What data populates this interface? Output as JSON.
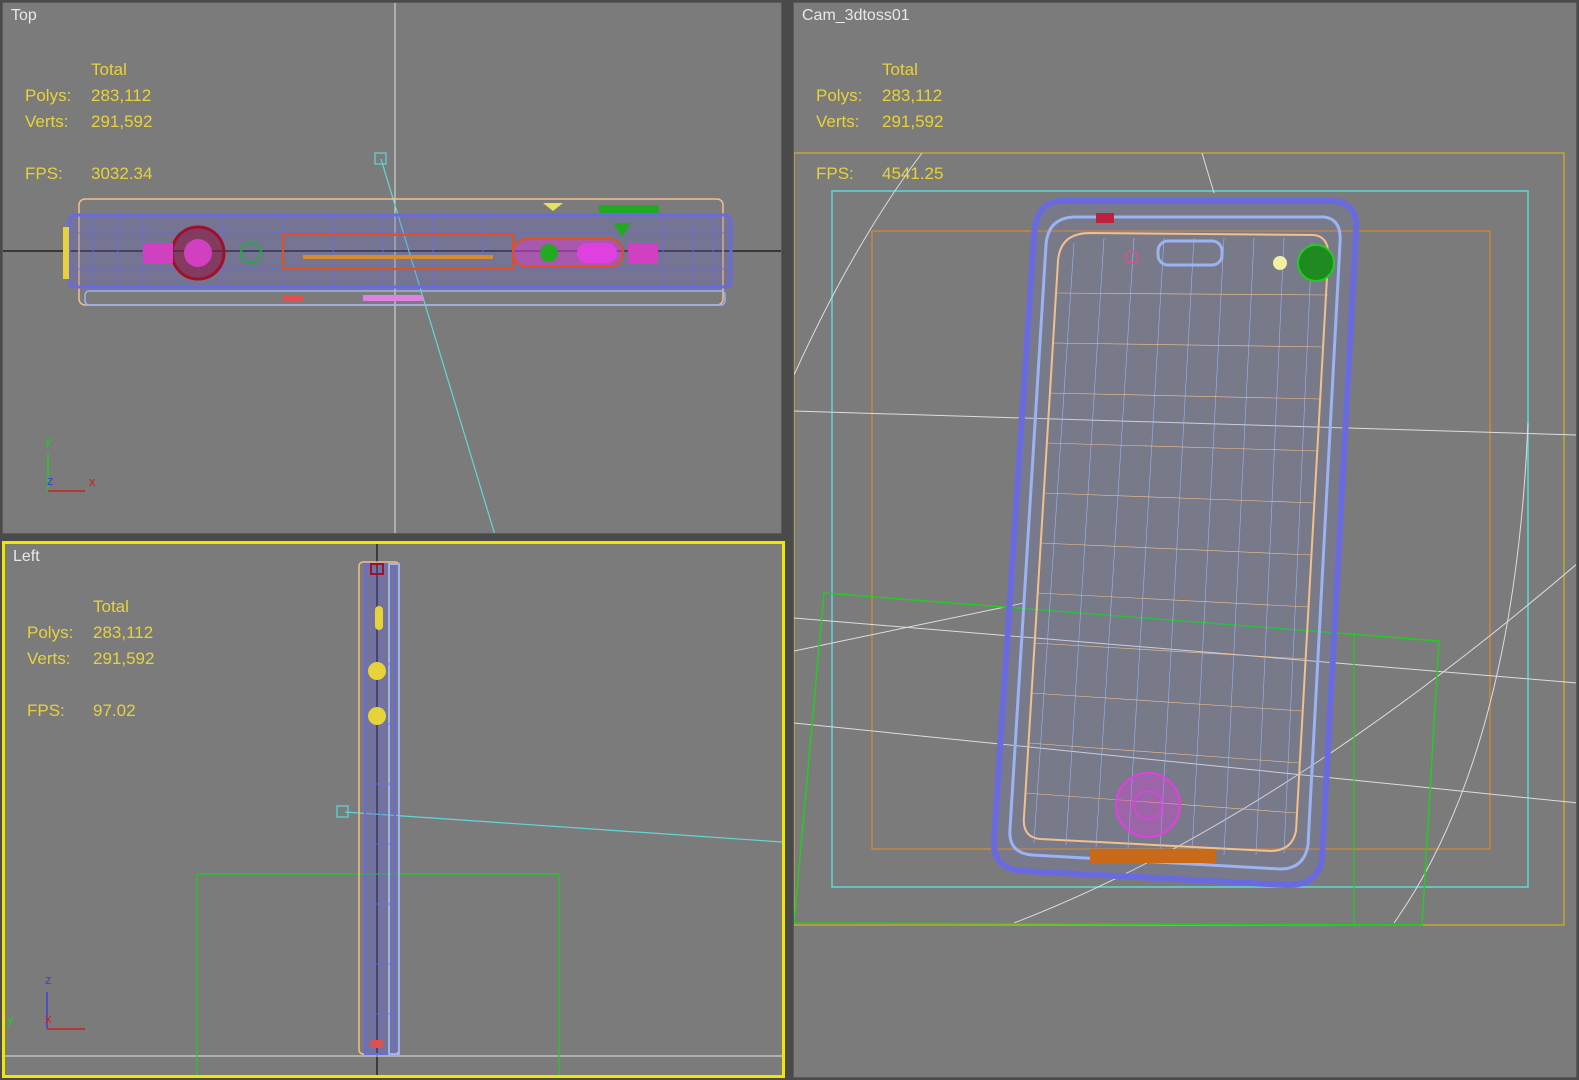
{
  "viewports": {
    "top": {
      "label": "Top",
      "stats": {
        "header": "Total",
        "polys_label": "Polys:",
        "polys": "283,112",
        "verts_label": "Verts:",
        "verts": "291,592",
        "fps_label": "FPS:",
        "fps": "3032.34"
      },
      "axes": {
        "v": "y",
        "h": "x",
        "d": "z"
      }
    },
    "left": {
      "label": "Left",
      "stats": {
        "header": "Total",
        "polys_label": "Polys:",
        "polys": "283,112",
        "verts_label": "Verts:",
        "verts": "291,592",
        "fps_label": "FPS:",
        "fps": "97.02"
      },
      "axes": {
        "v": "z",
        "h": "x",
        "d": "y"
      }
    },
    "cam": {
      "label": "Cam_3dtoss01",
      "stats": {
        "header": "Total",
        "polys_label": "Polys:",
        "polys": "283,112",
        "verts_label": "Verts:",
        "verts": "291,592",
        "fps_label": "FPS:",
        "fps": "4541.25"
      }
    }
  },
  "colors": {
    "viewport_bg": "#7b7b7b",
    "active_border": "#f2e600",
    "stats_text": "#e8d23a",
    "wire_blue": "#6a6ae0",
    "wire_light_blue": "#9bb3f2",
    "wire_peach": "#f2c08a",
    "wire_orange": "#d98a2a",
    "wire_green": "#22cc22",
    "wire_cyan": "#5fd8d8",
    "wire_magenta": "#e040e0"
  }
}
